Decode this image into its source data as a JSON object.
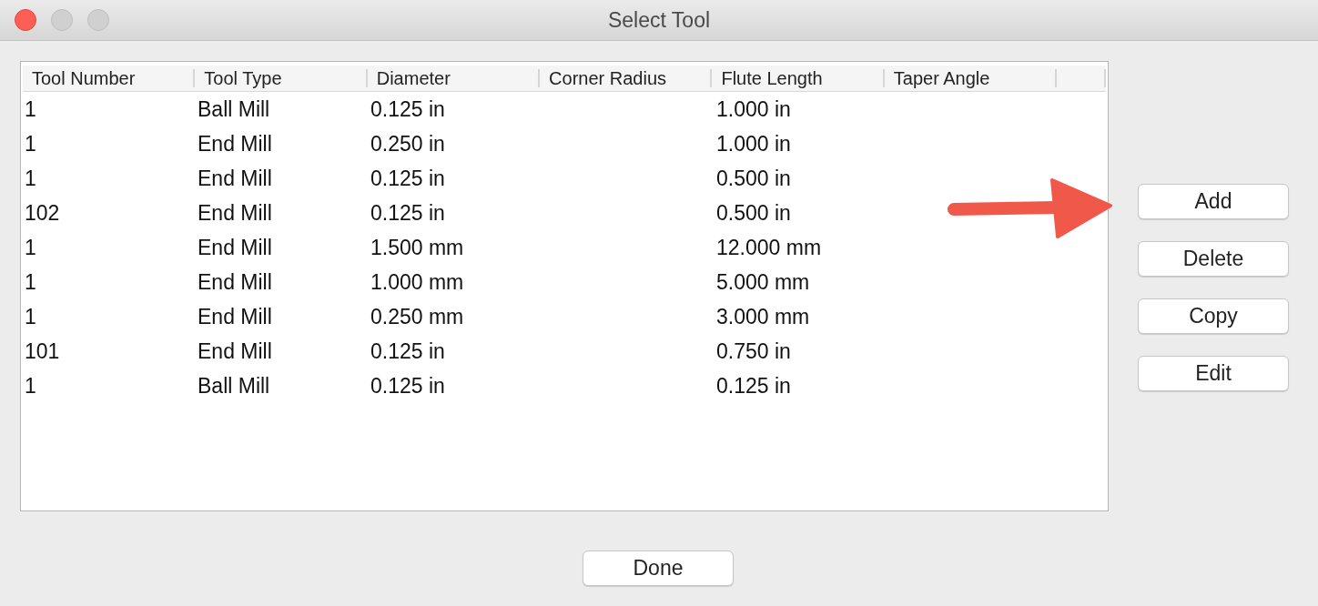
{
  "window": {
    "title": "Select Tool"
  },
  "table": {
    "columns": [
      "Tool Number",
      "Tool Type",
      "Diameter",
      "Corner Radius",
      "Flute Length",
      "Taper Angle"
    ],
    "rows": [
      [
        "1",
        "Ball Mill",
        "0.125 in",
        "",
        "1.000 in",
        ""
      ],
      [
        "1",
        "End Mill",
        "0.250 in",
        "",
        "1.000 in",
        ""
      ],
      [
        "1",
        "End Mill",
        "0.125 in",
        "",
        "0.500 in",
        ""
      ],
      [
        "102",
        "End Mill",
        "0.125 in",
        "",
        "0.500 in",
        ""
      ],
      [
        "1",
        "End Mill",
        "1.500 mm",
        "",
        "12.000 mm",
        ""
      ],
      [
        "1",
        "End Mill",
        "1.000 mm",
        "",
        "5.000 mm",
        ""
      ],
      [
        "1",
        "End Mill",
        "0.250 mm",
        "",
        "3.000 mm",
        ""
      ],
      [
        "101",
        "End Mill",
        "0.125 in",
        "",
        "0.750 in",
        ""
      ],
      [
        "1",
        "Ball Mill",
        "0.125 in",
        "",
        "0.125 in",
        ""
      ]
    ]
  },
  "side_buttons": [
    "Add",
    "Delete",
    "Copy",
    "Edit"
  ],
  "done_button": "Done"
}
